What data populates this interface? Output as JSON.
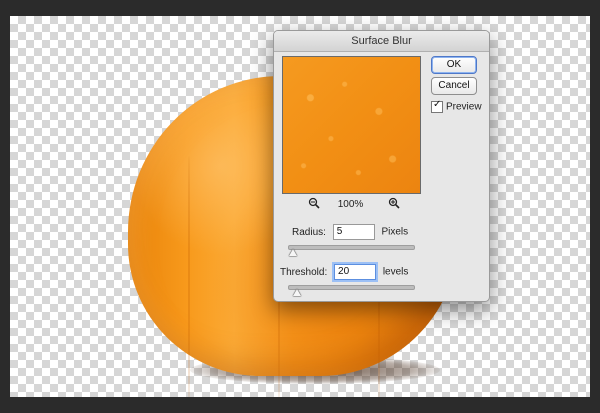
{
  "dialog": {
    "title": "Surface Blur",
    "ok_label": "OK",
    "cancel_label": "Cancel",
    "preview_label": "Preview",
    "preview_checked": true,
    "zoom_percent": "100%",
    "radius": {
      "label": "Radius:",
      "value": "5",
      "unit": "Pixels",
      "slider_fraction": 0.03
    },
    "threshold": {
      "label": "Threshold:",
      "value": "20",
      "unit": "levels",
      "slider_fraction": 0.06
    }
  },
  "colors": {
    "pumpkin": "#f89a1c",
    "dialog_bg": "#e7e7e7",
    "focus_ring": "#5c8fe0"
  }
}
